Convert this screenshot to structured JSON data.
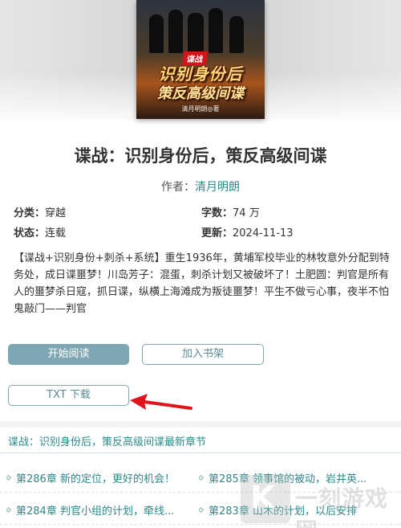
{
  "book": {
    "cover": {
      "tag": "谍战",
      "line1": "识别身份后",
      "line2": "策反高级间谍",
      "author": "清月明朗◎著"
    },
    "title": "谍战：识别身份后，策反高级间谍",
    "author_label": "作者：",
    "author_name": "清月明朗",
    "meta": {
      "category_label": "分类：",
      "category": "穿越",
      "words_label": "字数：",
      "words": "74 万",
      "status_label": "状态：",
      "status": "连载",
      "updated_label": "更新：",
      "updated": "2024-11-13"
    },
    "intro": "【谍战+识别身份+刺杀+系统】重生1936年，黄埔军校毕业的林牧意外分配到特务处，成日谍噩梦！川岛芳子：混蛋，刺杀计划又被破坏了！土肥圆：判官是所有人的噩梦杀日寇，抓日谍，纵横上海滩成为叛徒噩梦！平生不做亏心事，夜半不怕鬼敲门——判官"
  },
  "buttons": {
    "read": "开始阅读",
    "shelf": "加入书架",
    "txt": "TXT 下载"
  },
  "latest": {
    "heading": "谍战：识别身份后，策反高级间谍最新章节",
    "chapters": [
      "第286章 新的定位，更好的机会！",
      "第285章 领事馆的被动，岩井英...",
      "第284章 判官小组的计划，牵线...",
      "第283章 山木的计划，以后安排"
    ]
  },
  "watermark": {
    "mark": "K",
    "text": "一刻游戏网"
  },
  "colors": {
    "accent": "#2b8a8a",
    "button": "#7fa7b3",
    "arrow": "#e0141b"
  }
}
